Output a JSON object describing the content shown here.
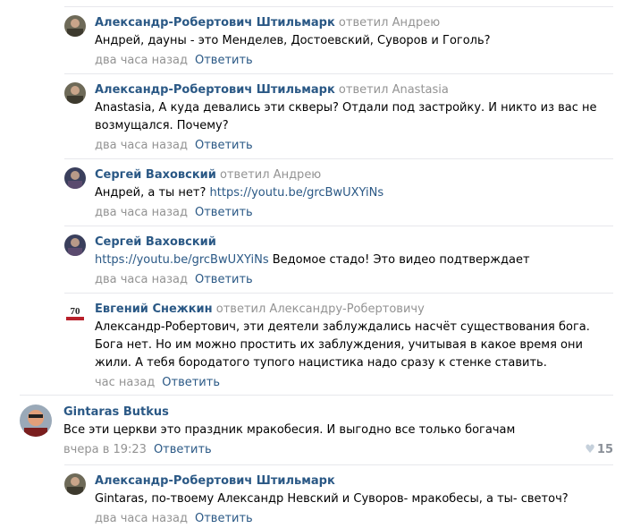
{
  "comments": [
    {
      "author": "Александр-Робертович Штильмарк",
      "replied": "ответил Андрею",
      "text": "Андрей, дауны - это Менделев, Достоевский, Суворов и Гоголь?",
      "link": "",
      "after": "",
      "time": "два часа назад",
      "reply_label": "Ответить"
    },
    {
      "author": "Александр-Робертович Штильмарк",
      "replied": "ответил Anastasia",
      "text": "Anastasia, А куда девались эти скверы? Отдали под застройку. И никто из вас не возмущался. Почему?",
      "link": "",
      "after": "",
      "time": "два часа назад",
      "reply_label": "Ответить"
    },
    {
      "author": "Сергей Ваховский",
      "replied": "ответил Андрею",
      "text": "Андрей, а ты нет? ",
      "link": "https://youtu.be/grcBwUXYiNs",
      "after": "",
      "time": "два часа назад",
      "reply_label": "Ответить"
    },
    {
      "author": "Сергей Ваховский",
      "replied": "",
      "text": "",
      "link": "https://youtu.be/grcBwUXYiNs",
      "after": " Ведомое стадо! Это видео подтверждает",
      "time": "два часа назад",
      "reply_label": "Ответить"
    },
    {
      "author": "Евгений Снежкин",
      "replied": "ответил Александру-Робертовичу",
      "text": "Александр-Робертович, эти деятели заблуждались насчёт существования бога. Бога нет. Но им можно простить их заблуждения, учитывая в какое время они жили. А тебя бородатого тупого нацистика надо сразу к стенке ставить.",
      "link": "",
      "after": "",
      "time": "час назад",
      "reply_label": "Ответить"
    },
    {
      "author": "Gintaras Butkus",
      "replied": "",
      "text": "Все эти церкви это праздник мракобесия. И выгодно все только богачам",
      "link": "",
      "after": "",
      "time": "вчера в 19:23",
      "reply_label": "Ответить",
      "likes": "15"
    },
    {
      "author": "Александр-Робертович Штильмарк",
      "replied": "",
      "text": "Gintaras, по-твоему Александр Невский и Суворов- мракобесы, а ты- светоч?",
      "link": "",
      "after": "",
      "time": "два часа назад",
      "reply_label": "Ответить"
    }
  ],
  "colors": {
    "link": "#2a5885",
    "muted": "#939393",
    "divider": "#e7e8ec"
  }
}
